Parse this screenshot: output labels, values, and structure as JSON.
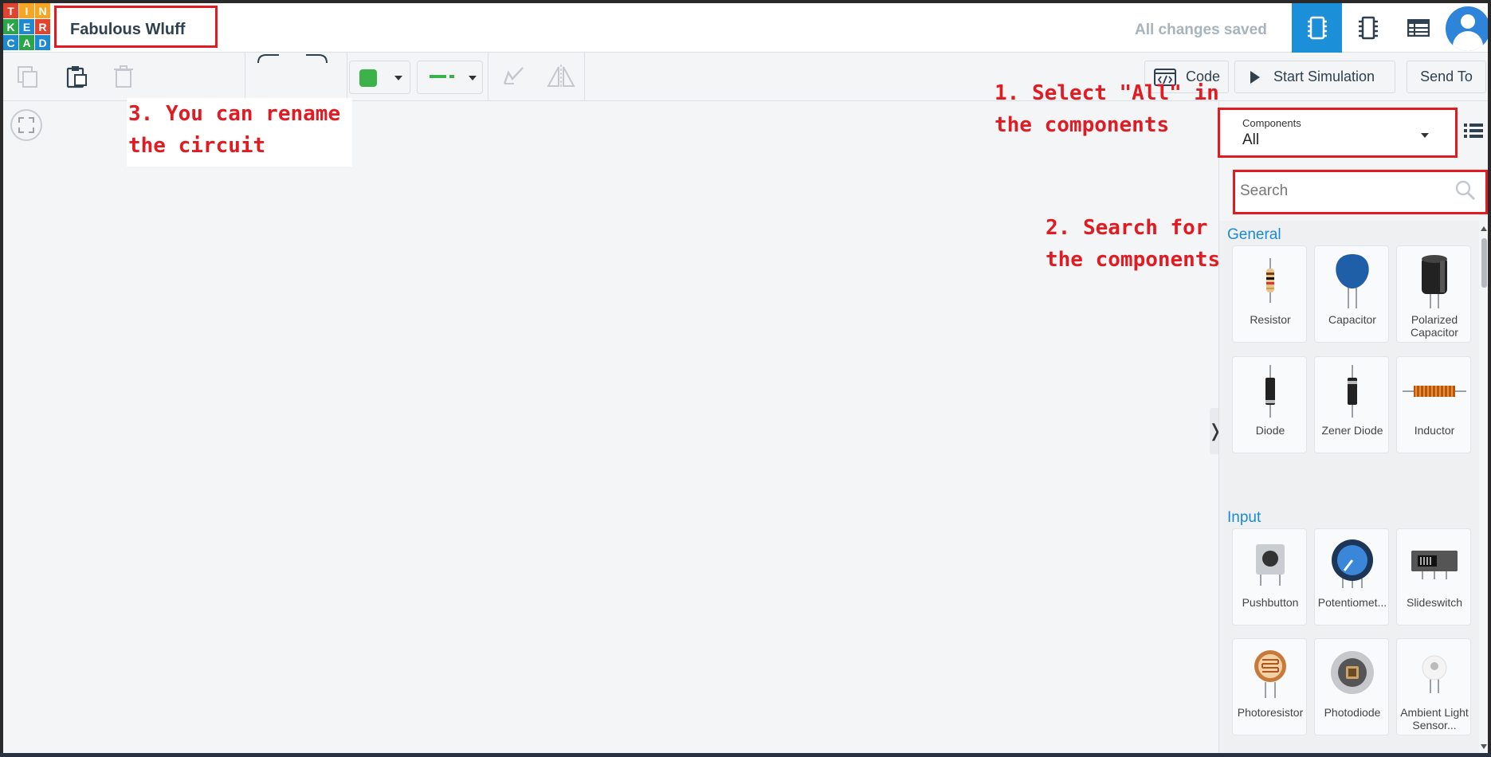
{
  "header": {
    "logo_letters": [
      "T",
      "I",
      "N",
      "K",
      "E",
      "R",
      "C",
      "A",
      "D"
    ],
    "logo_colors": [
      "#e2432e",
      "#f6a623",
      "#f6a623",
      "#2aa54a",
      "#1b8ad3",
      "#e2432e",
      "#1b8ad3",
      "#2aa54a",
      "#1b8ad3"
    ],
    "title": "Fabulous Wluff",
    "save_status": "All changes saved"
  },
  "toolbar": {
    "color_swatch": "#3bb34a",
    "code_label": "Code",
    "start_label": "Start Simulation",
    "send_label": "Send To"
  },
  "annotations": {
    "step1": "1. Select \"All\" in\nthe components",
    "step2": "2. Search for\nthe components",
    "step3": "3. You can rename\nthe circuit"
  },
  "panel": {
    "components_label": "Components",
    "components_value": "All",
    "search_placeholder": "Search",
    "sections": [
      {
        "title": "General",
        "items": [
          {
            "label": "Resistor"
          },
          {
            "label": "Capacitor"
          },
          {
            "label": "Polarized Capacitor"
          },
          {
            "label": "Diode"
          },
          {
            "label": "Zener Diode"
          },
          {
            "label": "Inductor"
          }
        ]
      },
      {
        "title": "Input",
        "items": [
          {
            "label": "Pushbutton"
          },
          {
            "label": "Potentiomet..."
          },
          {
            "label": "Slideswitch"
          },
          {
            "label": "Photoresistor"
          },
          {
            "label": "Photodiode"
          },
          {
            "label": "Ambient Light Sensor..."
          }
        ]
      }
    ]
  }
}
